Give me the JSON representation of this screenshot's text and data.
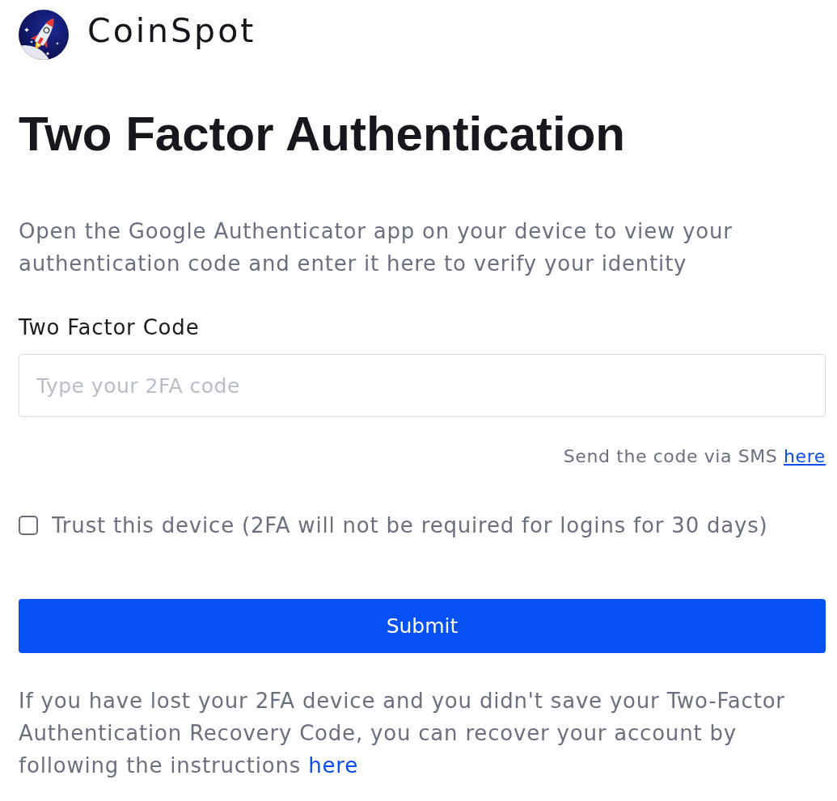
{
  "logo": {
    "name": "CoinSpot"
  },
  "heading": "Two Factor Authentication",
  "intro": "Open the Google Authenticator app on your device to view your authentication code and enter it here to verify your identity",
  "code_field": {
    "label": "Two Factor Code",
    "placeholder": "Type your 2FA code"
  },
  "sms_hint": {
    "text": "Send the code via SMS",
    "link": "here"
  },
  "trust_device": {
    "label": "Trust this device (2FA will not be required for logins for 30 days)",
    "checked": false
  },
  "submit_button": {
    "label": "Submit"
  },
  "recovery_note": {
    "text": "If you have lost your 2FA device and you didn't save your Two-Factor Authentication Recovery Code, you can recover your account by following the instructions",
    "link": "here"
  }
}
